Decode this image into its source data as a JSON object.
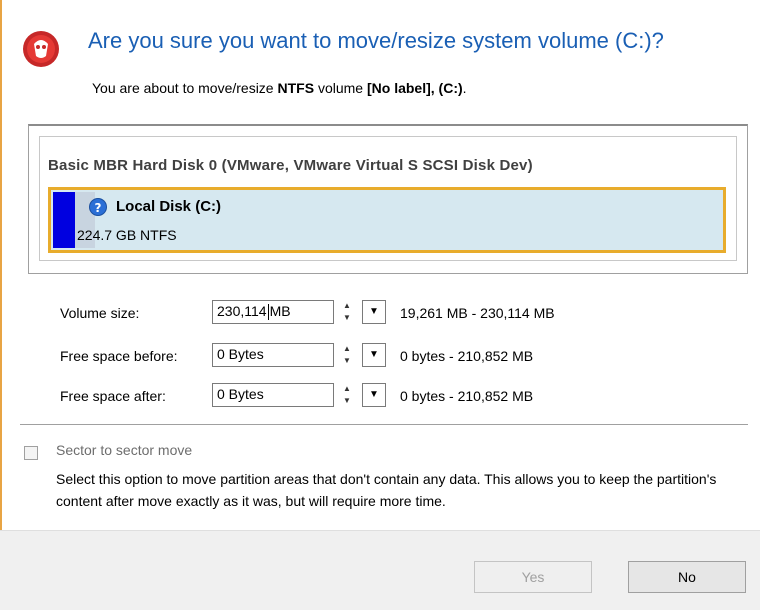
{
  "dialog": {
    "title": "Are you sure you want to move/resize system volume (C:)?",
    "subtitle_prefix": "You are about to move/resize ",
    "subtitle_fs": "NTFS",
    "subtitle_mid": " volume ",
    "subtitle_volume": "[No label], (C:)",
    "subtitle_end": "."
  },
  "disk": {
    "title": "Basic MBR Hard Disk 0 (VMware, VMware Virtual S SCSI Disk Dev)",
    "partition": {
      "name": "Local Disk (C:)",
      "size": "224.7 GB NTFS",
      "help_icon": "?"
    }
  },
  "fields": [
    {
      "label": "Volume size:",
      "value": "230,114",
      "unit": "MB",
      "range": "19,261 MB - 230,114 MB"
    },
    {
      "label": "Free space before:",
      "value": "0 Bytes",
      "range": "0 bytes - 210,852 MB"
    },
    {
      "label": "Free space after:",
      "value": "0 Bytes",
      "range": "0 bytes - 210,852 MB"
    }
  ],
  "option": {
    "label": "Sector to sector move",
    "checked": false,
    "description": "Select this option to move partition areas that don't contain any data. This allows you to keep the partition's content after move exactly as it was, but will require more time."
  },
  "buttons": {
    "yes": "Yes",
    "no": "No"
  },
  "icons": {
    "dialog_icon": "app-logo-icon",
    "spin_up": "▲",
    "spin_down": "▼",
    "dropdown": "▼"
  },
  "colors": {
    "title": "#1a5fb4",
    "partition_border": "#e8ac2c",
    "partition_bar": "#0000e0"
  }
}
